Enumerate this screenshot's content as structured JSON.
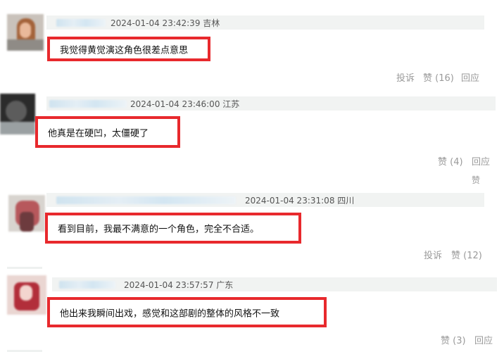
{
  "comments": [
    {
      "meta": "2024-01-04 23:42:39 吉林",
      "text": "我觉得黄觉演这角色很差点意思",
      "actions": {
        "report": "投诉",
        "like": "赞 (16)",
        "reply": "回应"
      }
    },
    {
      "meta": "2024-01-04 23:46:00 江苏",
      "text": "他真是在硬凹，太僵硬了",
      "actions": {
        "like": "赞 (4)",
        "reply": "回应",
        "like_extra": "赞"
      }
    },
    {
      "meta": "2024-01-04 23:31:08 四川",
      "text": "看到目前，我最不满意的一个角色，完全不合适。",
      "actions": {
        "report": "投诉",
        "like": "赞 (12)"
      }
    },
    {
      "meta": "2024-01-04 23:57:57 广东",
      "text": "他出来我瞬间出戏，感觉和这部剧的整体的风格不一致",
      "actions": {
        "like": "赞 (3)",
        "reply": "回应"
      }
    }
  ],
  "colors": {
    "highlight_border": "#e8292d",
    "header_bg": "#f1f3f2",
    "action_text": "#9a9a9a"
  }
}
